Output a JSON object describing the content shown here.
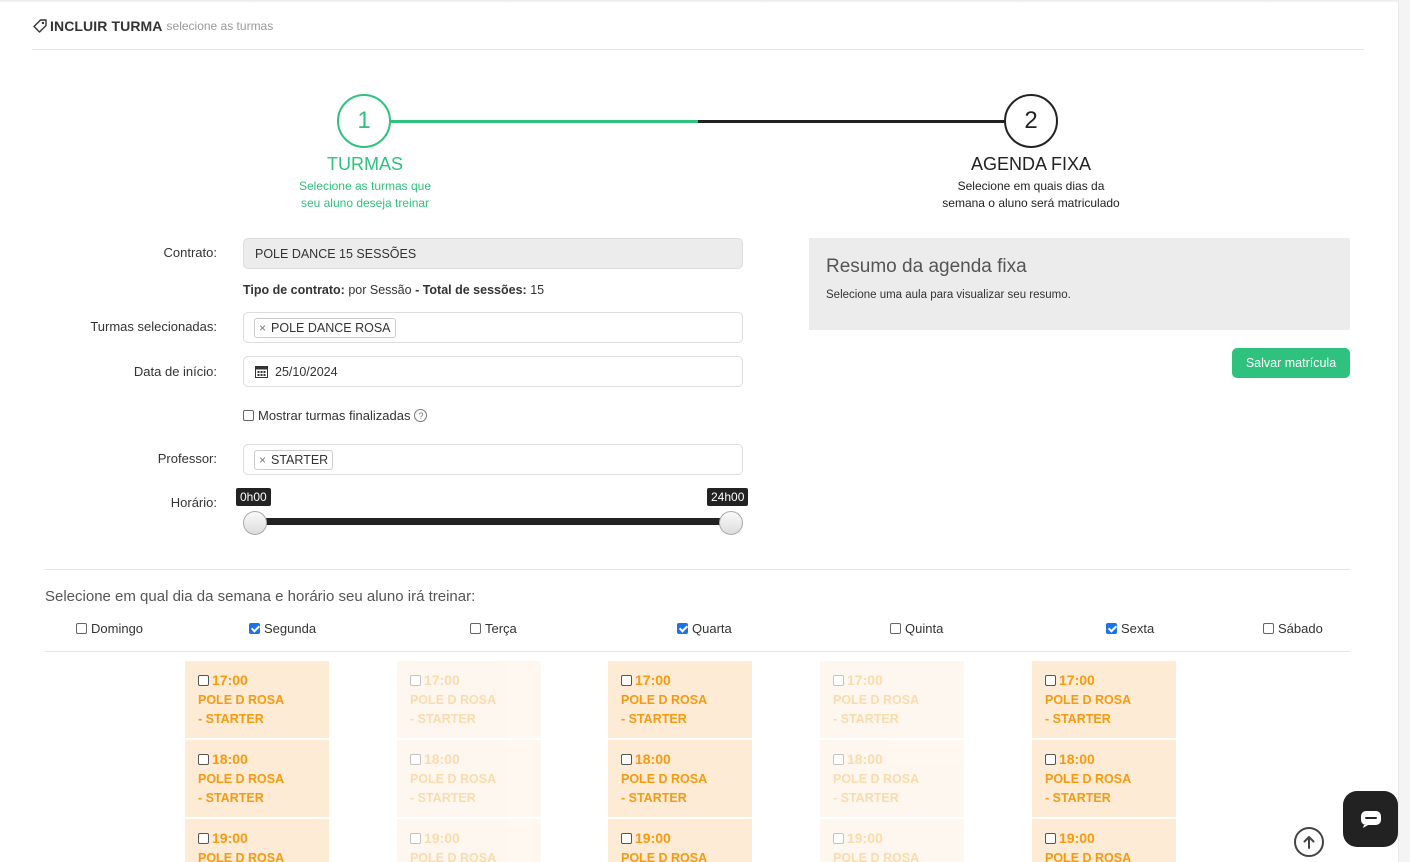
{
  "header": {
    "title": "INCLUIR TURMA",
    "subtitle": "selecione as turmas",
    "icon": "tag-icon"
  },
  "stepper": {
    "steps": [
      {
        "number": "1",
        "title": "TURMAS",
        "desc_line1": "Selecione as turmas que",
        "desc_line2": "seu aluno deseja treinar",
        "state": "active"
      },
      {
        "number": "2",
        "title": "AGENDA FIXA",
        "desc_line1": "Selecione em quais dias da",
        "desc_line2": "semana o aluno será matriculado",
        "state": "pending"
      }
    ],
    "colors": {
      "active": "#2ec27e",
      "pending": "#222222"
    }
  },
  "form": {
    "contrato_label": "Contrato:",
    "contrato_value": "POLE DANCE 15 SESSÕES",
    "tipo_label": "Tipo de contrato:",
    "tipo_value": "por Sessão",
    "sep": "-",
    "total_label": "Total de sessões:",
    "total_value": "15",
    "turmas_label": "Turmas selecionadas:",
    "turmas_chip": "POLE DANCE ROSA",
    "data_label": "Data de início:",
    "data_value": "25/10/2024",
    "mostrar_label": "Mostrar turmas finalizadas",
    "mostrar_checked": false,
    "professor_label": "Professor:",
    "professor_chip": "STARTER",
    "horario_label": "Horário:",
    "horario_min": "0h00",
    "horario_max": "24h00",
    "chip_remove": "×"
  },
  "summary": {
    "title": "Resumo da agenda fixa",
    "text": "Selecione uma aula para visualizar seu resumo.",
    "save_button": "Salvar matrícula"
  },
  "schedule": {
    "title": "Selecione em qual dia da semana e horário seu aluno irá treinar:",
    "days": [
      {
        "label": "Domingo",
        "checked": false
      },
      {
        "label": "Segunda",
        "checked": true
      },
      {
        "label": "Terça",
        "checked": false
      },
      {
        "label": "Quarta",
        "checked": true
      },
      {
        "label": "Quinta",
        "checked": false
      },
      {
        "label": "Sexta",
        "checked": true
      },
      {
        "label": "Sábado",
        "checked": false
      }
    ],
    "class_name": "POLE D ROSA",
    "class_prof": "- STARTER",
    "times": [
      "17:00",
      "18:00",
      "19:00"
    ],
    "card_color": "#fdebd6",
    "text_color": "#f59a11"
  }
}
